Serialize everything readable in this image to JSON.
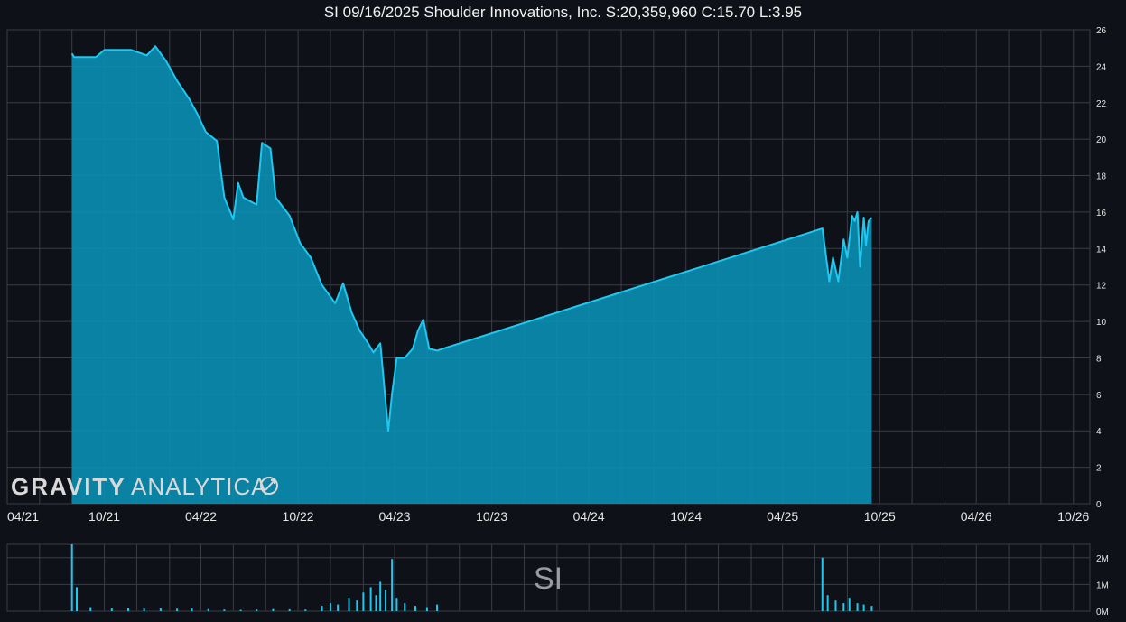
{
  "title": "SI 09/16/2025 Shoulder Innovations, Inc. S:20,359,960 C:15.70 L:3.95",
  "watermark": {
    "bold": "GRAVITY",
    "light": "ANALYTICA"
  },
  "volume_label": "SI",
  "colors": {
    "background": "#0f1118",
    "line": "#1ec8f0",
    "fill": "#0a8fb4",
    "grid": "#3a3d45",
    "text": "#e6e6e6"
  },
  "chart_data": [
    {
      "type": "area",
      "title": "SI 09/16/2025 Shoulder Innovations, Inc. S:20,359,960 C:15.70 L:3.95",
      "x_tick_labels": [
        "04/21",
        "10/21",
        "04/22",
        "10/22",
        "04/23",
        "10/23",
        "04/24",
        "10/24",
        "04/25",
        "10/25",
        "04/26",
        "10/26"
      ],
      "xlim": [
        "2021-04-01",
        "2026-11-01"
      ],
      "y_ticks": [
        0,
        2,
        4,
        6,
        8,
        10,
        12,
        14,
        16,
        18,
        20,
        22,
        24,
        26
      ],
      "ylim": [
        0,
        26
      ],
      "grid": true,
      "x": [
        "2021-08-01",
        "2021-08-05",
        "2021-09-15",
        "2021-10-01",
        "2021-10-20",
        "2021-11-20",
        "2021-12-20",
        "2022-01-05",
        "2022-01-25",
        "2022-02-15",
        "2022-03-10",
        "2022-03-25",
        "2022-04-10",
        "2022-05-01",
        "2022-05-15",
        "2022-06-01",
        "2022-06-10",
        "2022-06-20",
        "2022-07-15",
        "2022-07-25",
        "2022-08-10",
        "2022-08-20",
        "2022-09-15",
        "2022-10-05",
        "2022-10-25",
        "2022-11-15",
        "2022-12-10",
        "2022-12-25",
        "2023-01-10",
        "2023-01-25",
        "2023-02-10",
        "2023-02-20",
        "2023-03-05",
        "2023-03-20",
        "2023-03-27",
        "2023-04-05",
        "2023-04-20",
        "2023-05-05",
        "2023-05-15",
        "2023-05-25",
        "2023-06-05",
        "2023-06-20",
        "2023-06-30",
        "2025-06-15",
        "2025-06-20",
        "2025-06-28",
        "2025-07-05",
        "2025-07-15",
        "2025-07-25",
        "2025-08-01",
        "2025-08-10",
        "2025-08-15",
        "2025-08-20",
        "2025-08-25",
        "2025-09-01",
        "2025-09-05",
        "2025-09-10",
        "2025-09-16"
      ],
      "values": [
        24.7,
        24.5,
        24.5,
        24.9,
        24.9,
        24.9,
        24.6,
        25.1,
        24.3,
        23.2,
        22.2,
        21.4,
        20.4,
        19.9,
        16.8,
        15.6,
        17.6,
        16.8,
        16.4,
        19.8,
        19.5,
        16.8,
        15.8,
        14.3,
        13.5,
        12.0,
        11.0,
        12.1,
        10.5,
        9.5,
        8.8,
        8.3,
        8.8,
        4.0,
        6.0,
        8.0,
        8.0,
        8.5,
        9.5,
        10.1,
        8.5,
        8.4,
        8.5,
        15.1,
        14.0,
        12.2,
        13.5,
        12.2,
        14.5,
        13.5,
        15.8,
        15.5,
        16.0,
        13.0,
        15.7,
        14.2,
        15.5,
        15.7
      ],
      "series": [
        {
          "name": "",
          "values": []
        }
      ]
    },
    {
      "type": "bar",
      "title": "SI",
      "y_tick_labels": [
        "2M",
        "1M",
        "0M"
      ],
      "ylim": [
        0,
        2500000
      ],
      "x": [
        "2021-08-01",
        "2021-08-10",
        "2021-09-05",
        "2021-10-15",
        "2021-11-15",
        "2021-12-15",
        "2022-01-15",
        "2022-02-15",
        "2022-03-15",
        "2022-04-15",
        "2022-05-15",
        "2022-06-15",
        "2022-07-15",
        "2022-08-15",
        "2022-09-15",
        "2022-10-15",
        "2022-11-15",
        "2022-12-01",
        "2022-12-15",
        "2023-01-05",
        "2023-01-20",
        "2023-02-01",
        "2023-02-15",
        "2023-02-25",
        "2023-03-05",
        "2023-03-15",
        "2023-03-27",
        "2023-04-05",
        "2023-04-20",
        "2023-05-10",
        "2023-06-01",
        "2023-06-20",
        "2025-06-15",
        "2025-06-25",
        "2025-07-10",
        "2025-07-25",
        "2025-08-05",
        "2025-08-20",
        "2025-09-01",
        "2025-09-16"
      ],
      "values": [
        2500000,
        900000,
        150000,
        100000,
        120000,
        100000,
        110000,
        90000,
        100000,
        80000,
        60000,
        50000,
        60000,
        80000,
        70000,
        60000,
        200000,
        300000,
        250000,
        500000,
        400000,
        700000,
        900000,
        600000,
        1100000,
        800000,
        1950000,
        500000,
        300000,
        200000,
        150000,
        250000,
        2000000,
        600000,
        400000,
        300000,
        500000,
        300000,
        250000,
        200000
      ],
      "series": [
        {
          "name": "",
          "values": []
        }
      ]
    }
  ]
}
